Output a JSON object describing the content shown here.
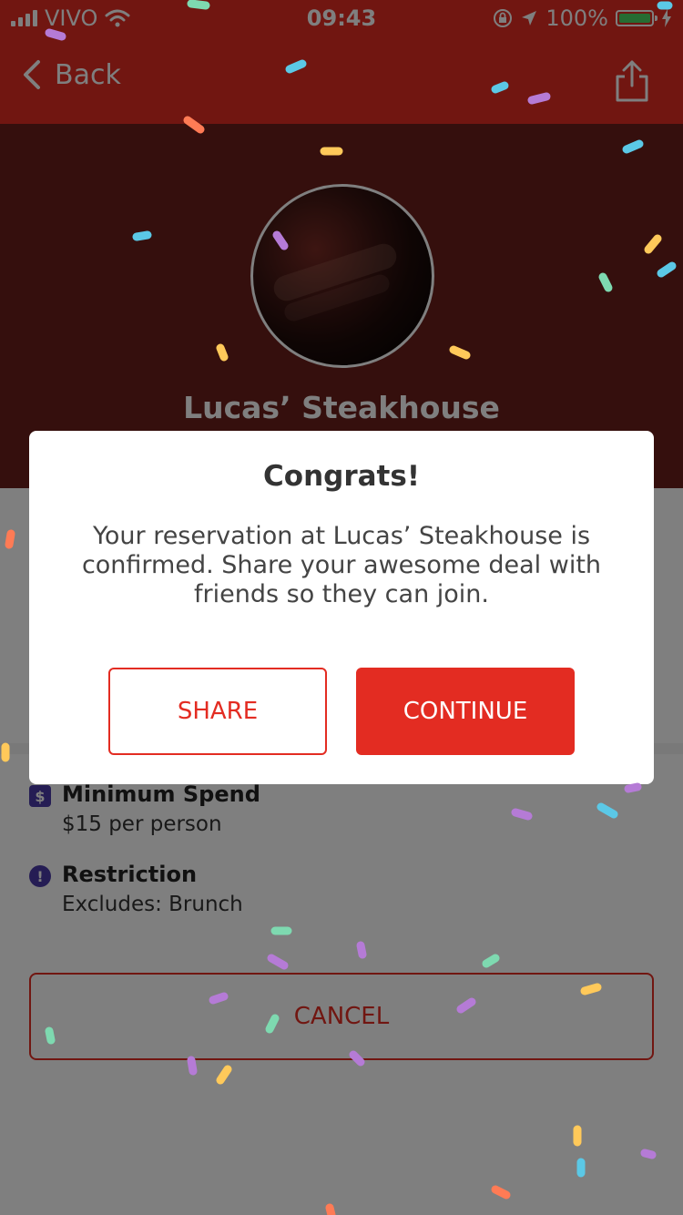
{
  "status_bar": {
    "carrier": "VIVO",
    "time": "09:43",
    "battery": "100%"
  },
  "nav": {
    "back_label": "Back"
  },
  "restaurant": {
    "name": "Lucas’ Steakhouse"
  },
  "details": {
    "min_spend_title": "Minimum Spend",
    "min_spend_value": "$15 per person",
    "restriction_title": "Restriction",
    "restriction_value": "Excludes: Brunch",
    "cancel_label": "CANCEL"
  },
  "modal": {
    "title": "Congrats!",
    "body": "Your reservation at Lucas’ Steakhouse is confirmed. Share your awesome deal with friends so they can join.",
    "share_label": "SHARE",
    "continue_label": "CONTINUE"
  },
  "colors": {
    "brand_red": "#e32c22",
    "confetti": [
      "#7ed9b0",
      "#5bc8e6",
      "#ffc95a",
      "#b57bd6",
      "#ff7b55"
    ]
  },
  "icons": {
    "dollar": "$",
    "restriction": "!"
  }
}
